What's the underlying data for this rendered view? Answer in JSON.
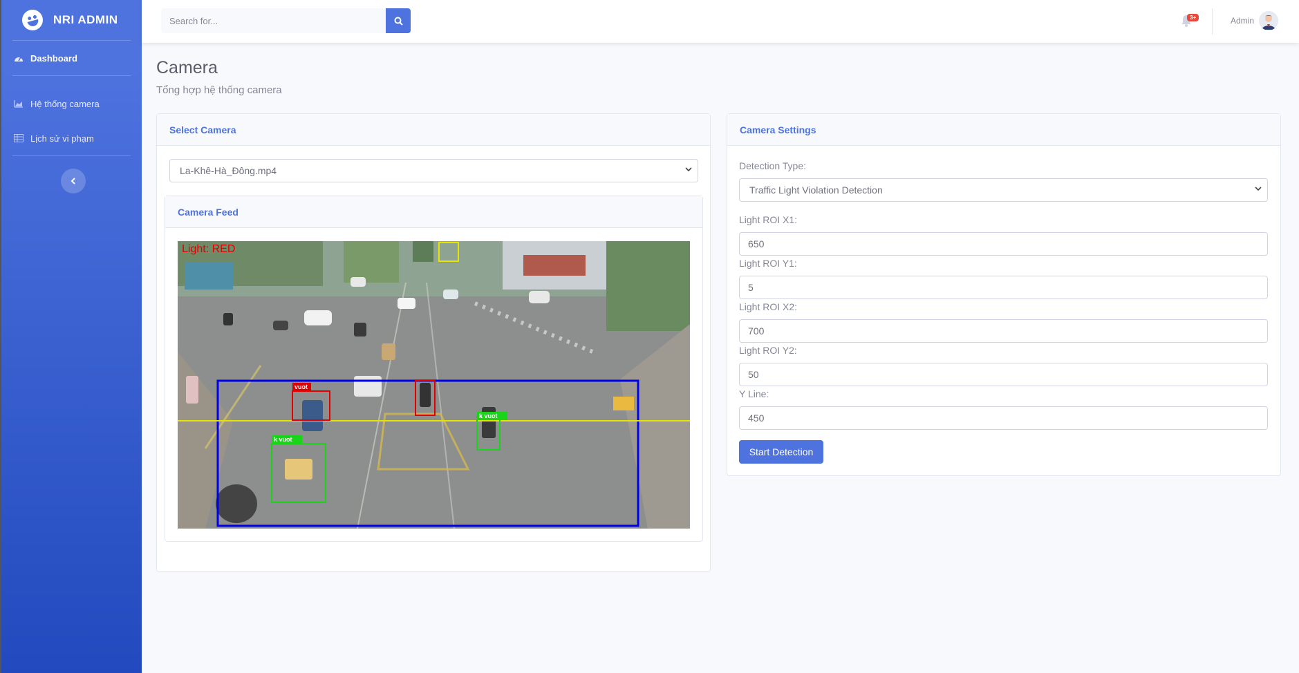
{
  "brand": {
    "name": "NRI ADMIN"
  },
  "sidebar": {
    "items": [
      {
        "label": "Dashboard",
        "icon": "tachometer-icon"
      },
      {
        "label": "Hệ thống camera",
        "icon": "chart-area-icon"
      },
      {
        "label": "Lịch sử vi phạm",
        "icon": "table-icon"
      }
    ],
    "toggle_icon": "chevron-left-icon"
  },
  "topbar": {
    "search_placeholder": "Search for...",
    "alerts_badge": "3+",
    "user_name": "Admin"
  },
  "page": {
    "title": "Camera",
    "subtitle": "Tổng hợp hệ thống camera"
  },
  "select_camera": {
    "header": "Select Camera",
    "selected": "La-Khê-Hà_Đông.mp4",
    "feed_header": "Camera Feed",
    "overlay_text": "Light: RED",
    "detections": [
      {
        "label": "vuot",
        "color": "#e00000"
      },
      {
        "label": "k vuot",
        "color": "#19d419"
      },
      {
        "label": "k vuot",
        "color": "#19d419"
      }
    ]
  },
  "settings": {
    "header": "Camera Settings",
    "detection_type_label": "Detection Type:",
    "detection_type": "Traffic Light Violation Detection",
    "fields": [
      {
        "label": "Light ROI X1:",
        "value": "650"
      },
      {
        "label": "Light ROI Y1:",
        "value": "5"
      },
      {
        "label": "Light ROI X2:",
        "value": "700"
      },
      {
        "label": "Light ROI Y2:",
        "value": "50"
      },
      {
        "label": "Y Line:",
        "value": "450"
      }
    ],
    "start_label": "Start Detection"
  },
  "colors": {
    "primary": "#4e73df",
    "danger": "#e74a3b"
  }
}
